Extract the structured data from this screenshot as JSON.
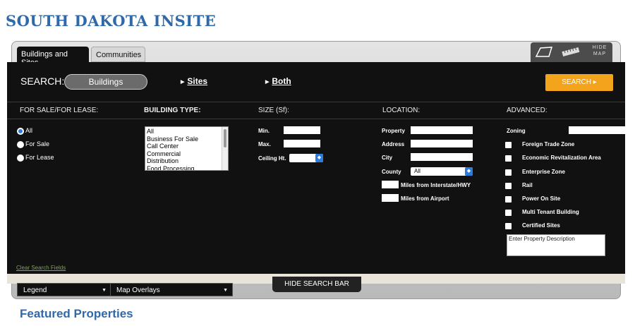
{
  "site": {
    "title": "SOUTH DAKOTA INSITE"
  },
  "tabs": [
    {
      "label": "Buildings and Sites",
      "caret": "▴"
    },
    {
      "label": "Communities",
      "caret": "▾"
    }
  ],
  "map_tools": {
    "hide_map_line1": "HIDE",
    "hide_map_line2": "MAP"
  },
  "search": {
    "label": "SEARCH:",
    "mode_selected": "Buildings",
    "links": [
      "Sites",
      "Both"
    ],
    "button": "SEARCH",
    "button_arrow": "▸"
  },
  "columns": {
    "sale": "FOR SALE/FOR LEASE:",
    "type": "BUILDING TYPE:",
    "size": "SIZE (Sf):",
    "location": "LOCATION:",
    "advanced": "ADVANCED:"
  },
  "sale_options": [
    {
      "label": "All",
      "checked": true
    },
    {
      "label": "For Sale",
      "checked": false
    },
    {
      "label": "For Lease",
      "checked": false
    }
  ],
  "building_types": [
    "All",
    "Business For Sale",
    "Call Center",
    "Commercial",
    "Distribution",
    "Food Processing"
  ],
  "size_fields": {
    "min": "Min.",
    "max": "Max.",
    "ceiling": "Ceiling Ht."
  },
  "location_fields": {
    "property": "Property",
    "address": "Address",
    "city": "City",
    "county": "County",
    "county_value": "All",
    "miles_interstate": "Miles from Interstate/HWY",
    "miles_airport": "Miles from Airport"
  },
  "advanced": {
    "zoning": "Zoning",
    "checks": [
      "Foreign Trade Zone",
      "Economic Revitalization Area",
      "Enterprise Zone",
      "Rail",
      "Power On Site",
      "Multi Tenant Building",
      "Certified Sites"
    ],
    "description_placeholder": "Enter Property Description"
  },
  "clear_link": "Clear Search Fields",
  "bottom": {
    "legend": "Legend",
    "overlays": "Map Overlays",
    "hide_search": "HIDE SEARCH BAR"
  },
  "featured_heading": "Featured Properties",
  "colors": {
    "brand_blue": "#2f69a9",
    "accent_orange": "#f4a31c",
    "radio_blue": "#2c7be0",
    "panel_bg": "#111111"
  }
}
